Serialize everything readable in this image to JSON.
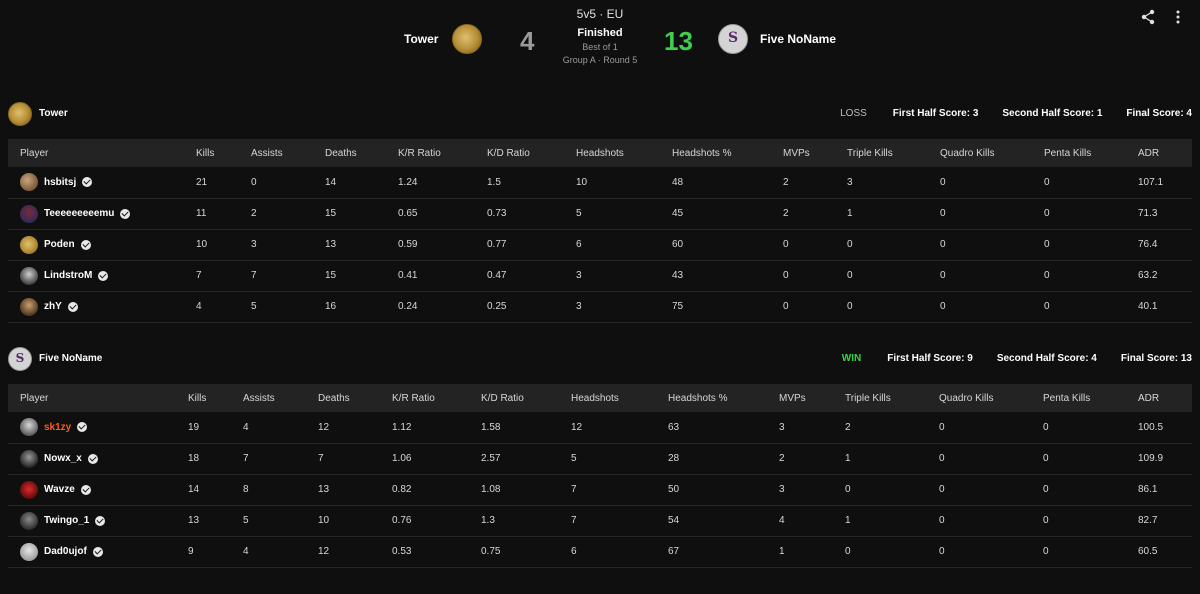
{
  "match": {
    "mode": "5v5 · EU",
    "status": "Finished",
    "best_of": "Best of 1",
    "round": "Group A · Round 5",
    "left_team": "Tower",
    "right_team": "Five NoName",
    "left_score": "4",
    "right_score": "13"
  },
  "colors": {
    "win": "#3ecf4c",
    "highlight_player": "#ff5a1f",
    "background": "#0f0f0f",
    "table_header": "#232323"
  },
  "icons": {
    "share": "share-icon",
    "more": "more-vertical-icon",
    "verified": "verified-check-icon"
  },
  "columns": [
    "Player",
    "Kills",
    "Assists",
    "Deaths",
    "K/R Ratio",
    "K/D Ratio",
    "Headshots",
    "Headshots %",
    "MVPs",
    "Triple Kills",
    "Quadro Kills",
    "Penta Kills",
    "ADR"
  ],
  "teams": [
    {
      "name": "Tower",
      "result": "LOSS",
      "first_half": "First Half Score: 3",
      "second_half": "Second Half Score: 1",
      "final": "Final Score: 4",
      "players": [
        {
          "name": "hsbitsj",
          "stats": [
            "21",
            "0",
            "14",
            "1.24",
            "1.5",
            "10",
            "48",
            "2",
            "3",
            "0",
            "0",
            "107.1"
          ]
        },
        {
          "name": "Teeeeeeeeemu",
          "stats": [
            "11",
            "2",
            "15",
            "0.65",
            "0.73",
            "5",
            "45",
            "2",
            "1",
            "0",
            "0",
            "71.3"
          ]
        },
        {
          "name": "Poden",
          "stats": [
            "10",
            "3",
            "13",
            "0.59",
            "0.77",
            "6",
            "60",
            "0",
            "0",
            "0",
            "0",
            "76.4"
          ]
        },
        {
          "name": "LindstroM",
          "stats": [
            "7",
            "7",
            "15",
            "0.41",
            "0.47",
            "3",
            "43",
            "0",
            "0",
            "0",
            "0",
            "63.2"
          ]
        },
        {
          "name": "zhY",
          "stats": [
            "4",
            "5",
            "16",
            "0.24",
            "0.25",
            "3",
            "75",
            "0",
            "0",
            "0",
            "0",
            "40.1"
          ]
        }
      ]
    },
    {
      "name": "Five NoName",
      "result": "WIN",
      "first_half": "First Half Score: 9",
      "second_half": "Second Half Score: 4",
      "final": "Final Score: 13",
      "players": [
        {
          "name": "sk1zy",
          "stats": [
            "19",
            "4",
            "12",
            "1.12",
            "1.58",
            "12",
            "63",
            "3",
            "2",
            "0",
            "0",
            "100.5"
          ]
        },
        {
          "name": "Nowx_x",
          "stats": [
            "18",
            "7",
            "7",
            "1.06",
            "2.57",
            "5",
            "28",
            "2",
            "1",
            "0",
            "0",
            "109.9"
          ]
        },
        {
          "name": "Wavze",
          "stats": [
            "14",
            "8",
            "13",
            "0.82",
            "1.08",
            "7",
            "50",
            "3",
            "0",
            "0",
            "0",
            "86.1"
          ]
        },
        {
          "name": "Twingo_1",
          "stats": [
            "13",
            "5",
            "10",
            "0.76",
            "1.3",
            "7",
            "54",
            "4",
            "1",
            "0",
            "0",
            "82.7"
          ]
        },
        {
          "name": "Dad0ujof",
          "stats": [
            "9",
            "4",
            "12",
            "0.53",
            "0.75",
            "6",
            "67",
            "1",
            "0",
            "0",
            "0",
            "60.5"
          ]
        }
      ]
    }
  ]
}
